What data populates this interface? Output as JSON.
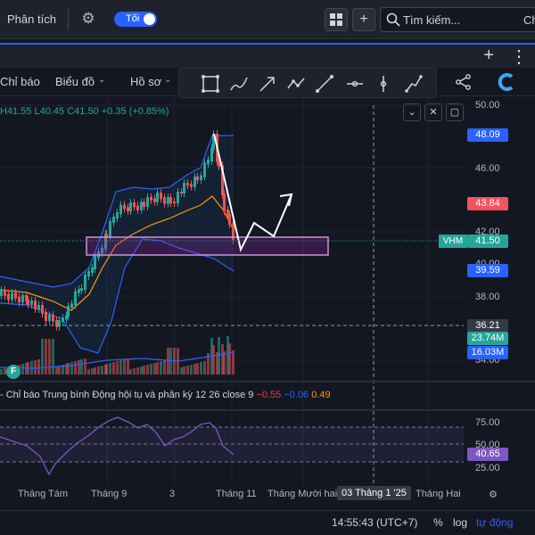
{
  "header": {
    "title": "Phân tích",
    "theme_label": "Tối",
    "search_placeholder": "Tìm kiếm...",
    "search_extra": "Ch"
  },
  "toolbar": {
    "indicators_label": "Chỉ báo",
    "chart_label": "Biểu đồ",
    "profile_label": "Hồ sơ"
  },
  "symbol": {
    "ticker": "VHM",
    "ohlc_text": "H41.55 L40.45 C41.50 +0.35 (+0.85%)"
  },
  "price_axis": {
    "ticks": [
      "50.00",
      "46.00",
      "42.00",
      "40.00",
      "38.00",
      "36.00",
      "34.00"
    ],
    "tags": {
      "upper_band": "48.09",
      "ma": "43.84",
      "last": "41.50",
      "lower_band": "39.59",
      "crosshair": "36.21",
      "volume": "23.74M",
      "volume_ma": "16.03M"
    },
    "colors": {
      "upper_band": "#2962ff",
      "ma": "#f7525f",
      "last": "#26a69a",
      "lower_band": "#2962ff",
      "crosshair": "#363a45",
      "volume": "#26a69a",
      "volume_ma": "#2962ff"
    }
  },
  "macd": {
    "label": "Chỉ báo Trung bình Động hội tụ và phân kỳ",
    "params": "12 26 close 9",
    "v1": "−0.55",
    "v2": "−0.06",
    "v3": "0.49"
  },
  "rsi": {
    "ticks": [
      "75.00",
      "50.00",
      "25.00"
    ],
    "value": "40.65",
    "value_color": "#7e57c2"
  },
  "time_axis": {
    "labels": [
      "Tháng Tám",
      "Tháng 9",
      "3",
      "Tháng 11",
      "Tháng Mười hai",
      "Tháng Hai"
    ],
    "selected": "03 Tháng 1 '25"
  },
  "footer": {
    "time": "14:55:43 (UTC+7)",
    "percent": "%",
    "log": "log",
    "auto": "tự động"
  },
  "badge": "F",
  "colors": {
    "bg": "#131722",
    "up": "#26a69a",
    "down": "#ef5350",
    "accent": "#2962ff"
  }
}
